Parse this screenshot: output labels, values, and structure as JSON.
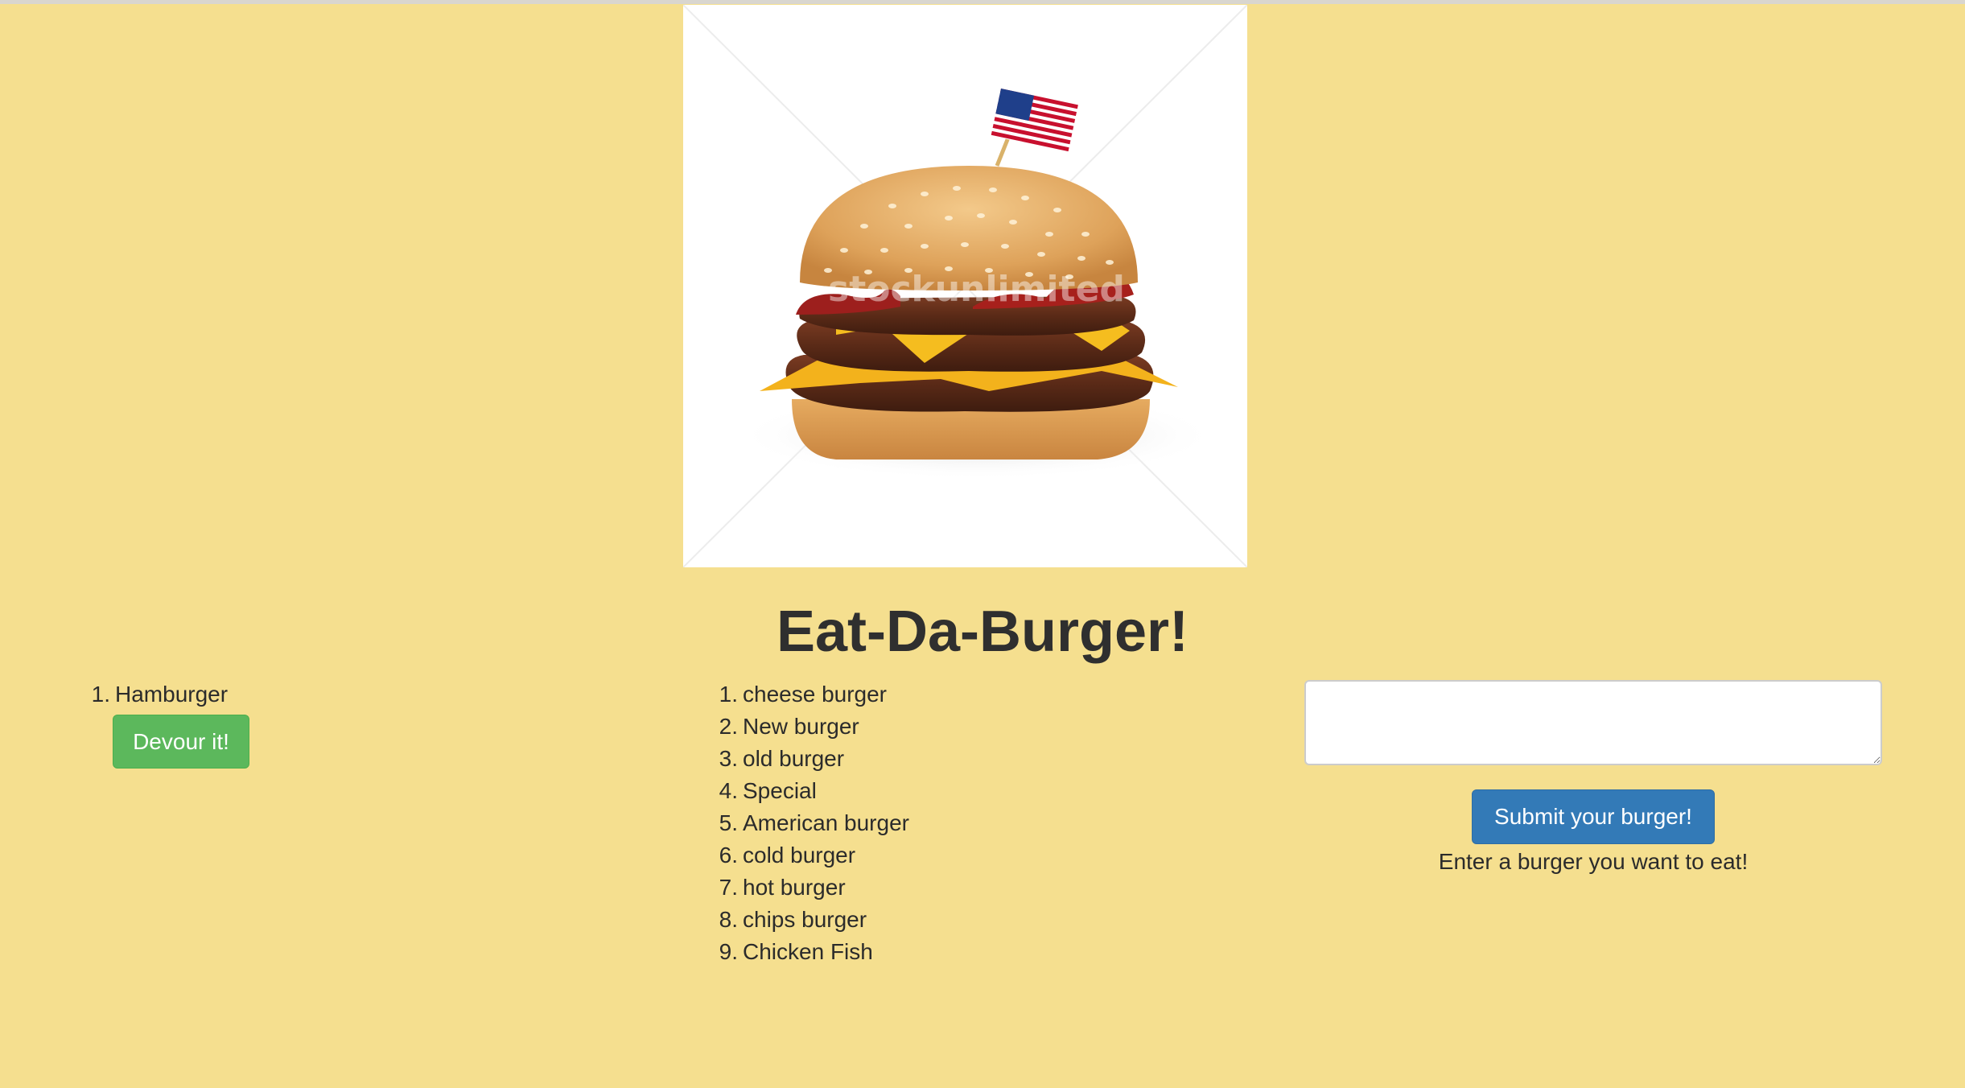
{
  "header": {
    "title": "Eat-Da-Burger!",
    "image_alt": "burger-illustration",
    "image_watermark": "stockunlimited"
  },
  "uneaten": {
    "items": [
      {
        "number": "1.",
        "name": "Hamburger",
        "button_label": "Devour it!"
      }
    ]
  },
  "devoured": {
    "items": [
      {
        "number": "1.",
        "name": "cheese burger"
      },
      {
        "number": "2.",
        "name": "New burger"
      },
      {
        "number": "3.",
        "name": "old burger"
      },
      {
        "number": "4.",
        "name": "Special"
      },
      {
        "number": "5.",
        "name": "American burger"
      },
      {
        "number": "6.",
        "name": "cold burger"
      },
      {
        "number": "7.",
        "name": "hot burger"
      },
      {
        "number": "8.",
        "name": "chips burger"
      },
      {
        "number": "9.",
        "name": "Chicken Fish"
      }
    ]
  },
  "form": {
    "input_value": "",
    "submit_label": "Submit your burger!",
    "helper_text": "Enter a burger you want to eat!"
  },
  "colors": {
    "page_background": "#f5df8f",
    "devour_button": "#5cb85c",
    "submit_button": "#337ab7",
    "text": "#2b2b2b"
  }
}
